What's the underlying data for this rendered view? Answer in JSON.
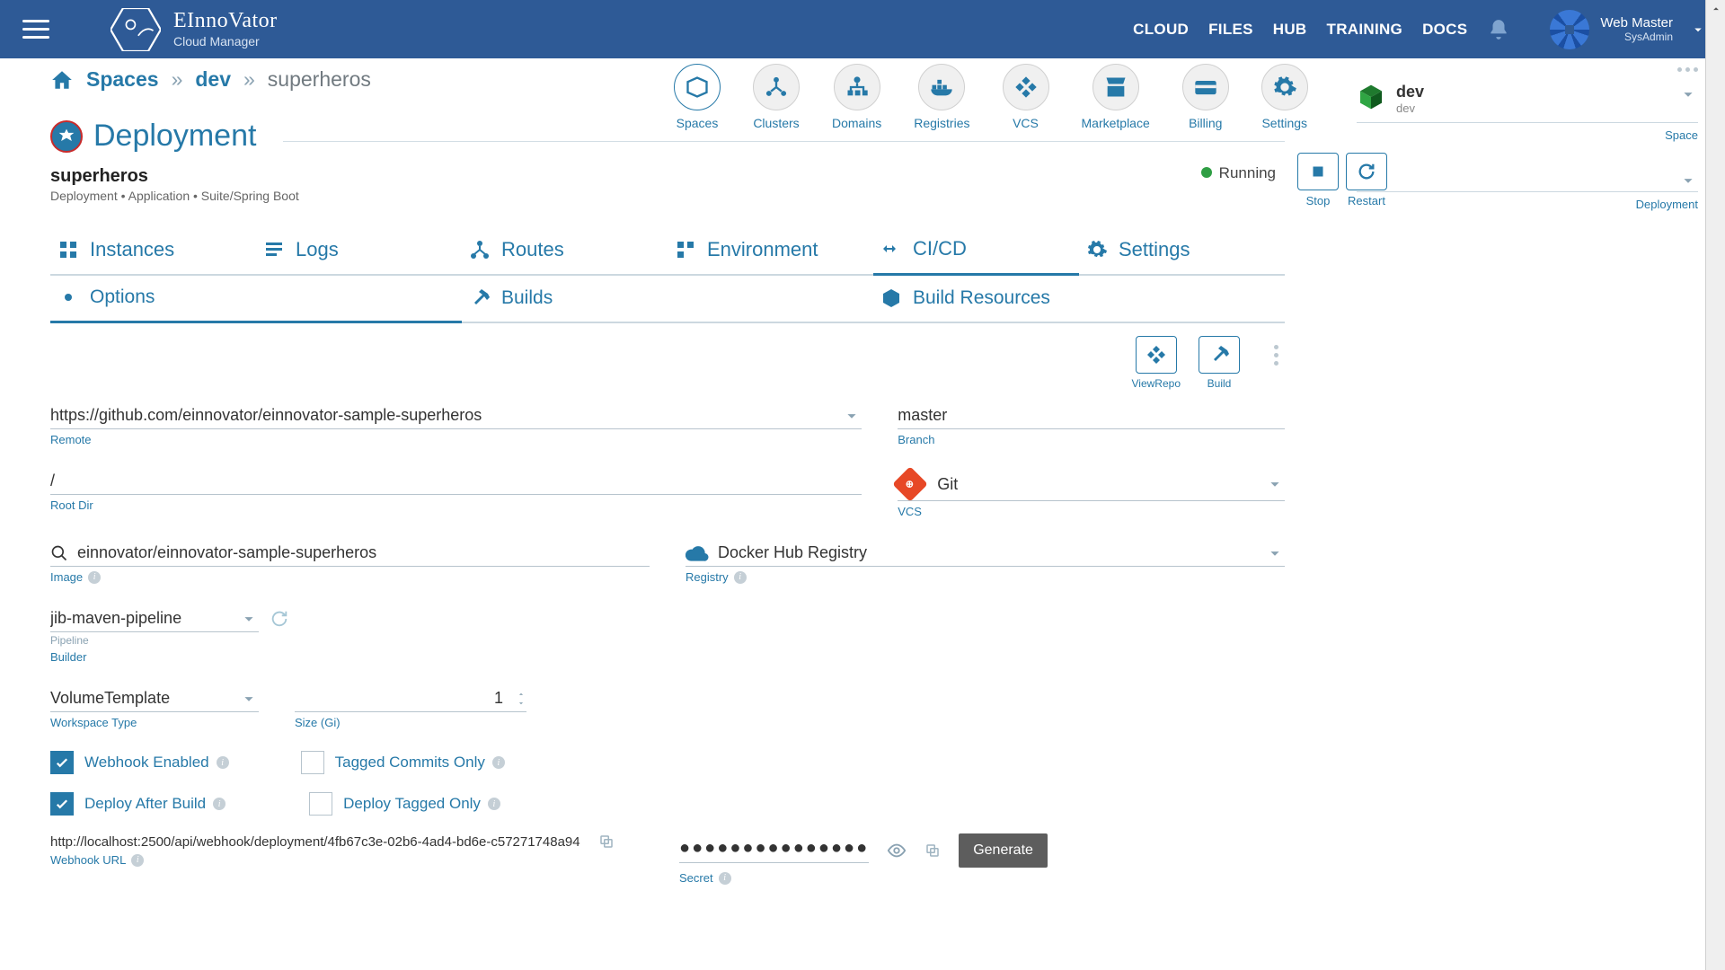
{
  "brand": {
    "main": "EInnoVator",
    "sub": "Cloud Manager"
  },
  "nav": {
    "cloud": "CLOUD",
    "files": "FILES",
    "hub": "HUB",
    "training": "TRAINING",
    "docs": "DOCS"
  },
  "user": {
    "name": "Web Master",
    "role": "SysAdmin"
  },
  "breadcrumb": {
    "root": "Spaces",
    "space": "dev",
    "deploy": "superheros"
  },
  "iconNav": {
    "spaces": "Spaces",
    "clusters": "Clusters",
    "domains": "Domains",
    "registries": "Registries",
    "vcs": "VCS",
    "marketplace": "Marketplace",
    "billing": "Billing",
    "settings": "Settings"
  },
  "deploy": {
    "title": "Deployment",
    "name": "superheros",
    "meta": "Deployment • Application • Suite/Spring Boot",
    "status": "Running"
  },
  "squareActions": {
    "stop": "Stop",
    "restart": "Restart"
  },
  "tabs1": {
    "instances": "Instances",
    "logs": "Logs",
    "routes": "Routes",
    "environment": "Environment",
    "cicd": "CI/CD",
    "settings": "Settings"
  },
  "tabs2": {
    "options": "Options",
    "builds": "Builds",
    "buildResources": "Build Resources"
  },
  "actions": {
    "viewRepo": "ViewRepo",
    "build": "Build"
  },
  "form": {
    "remote": {
      "value": "https://github.com/einnovator/einnovator-sample-superheros",
      "label": "Remote"
    },
    "branch": {
      "value": "master",
      "label": "Branch"
    },
    "rootDir": {
      "value": "/",
      "label": "Root Dir"
    },
    "vcs": {
      "value": "Git",
      "label": "VCS"
    },
    "image": {
      "value": "einnovator/einnovator-sample-superheros",
      "label": "Image"
    },
    "registry": {
      "value": "Docker Hub Registry",
      "label": "Registry"
    },
    "pipeline": {
      "value": "jib-maven-pipeline",
      "sub": "Pipeline",
      "label": "Builder"
    },
    "workspaceType": {
      "value": "VolumeTemplate",
      "label": "Workspace Type"
    },
    "size": {
      "value": "1",
      "label": "Size (Gi)"
    },
    "webhookEnabled": "Webhook Enabled",
    "taggedCommits": "Tagged Commits Only",
    "deployAfterBuild": "Deploy After Build",
    "deployTagged": "Deploy Tagged Only",
    "webhookUrl": {
      "value": "http://localhost:2500/api/webhook/deployment/4fb67c3e-02b6-4ad4-bd6e-c57271748a94",
      "label": "Webhook URL"
    },
    "secret": {
      "masked": "●●●●●●●●●●●●●●●",
      "label": "Secret"
    },
    "generate": "Generate"
  },
  "side": {
    "space": {
      "name": "dev",
      "sub": "dev",
      "tag": "Space"
    },
    "deployTag": "Deployment"
  }
}
